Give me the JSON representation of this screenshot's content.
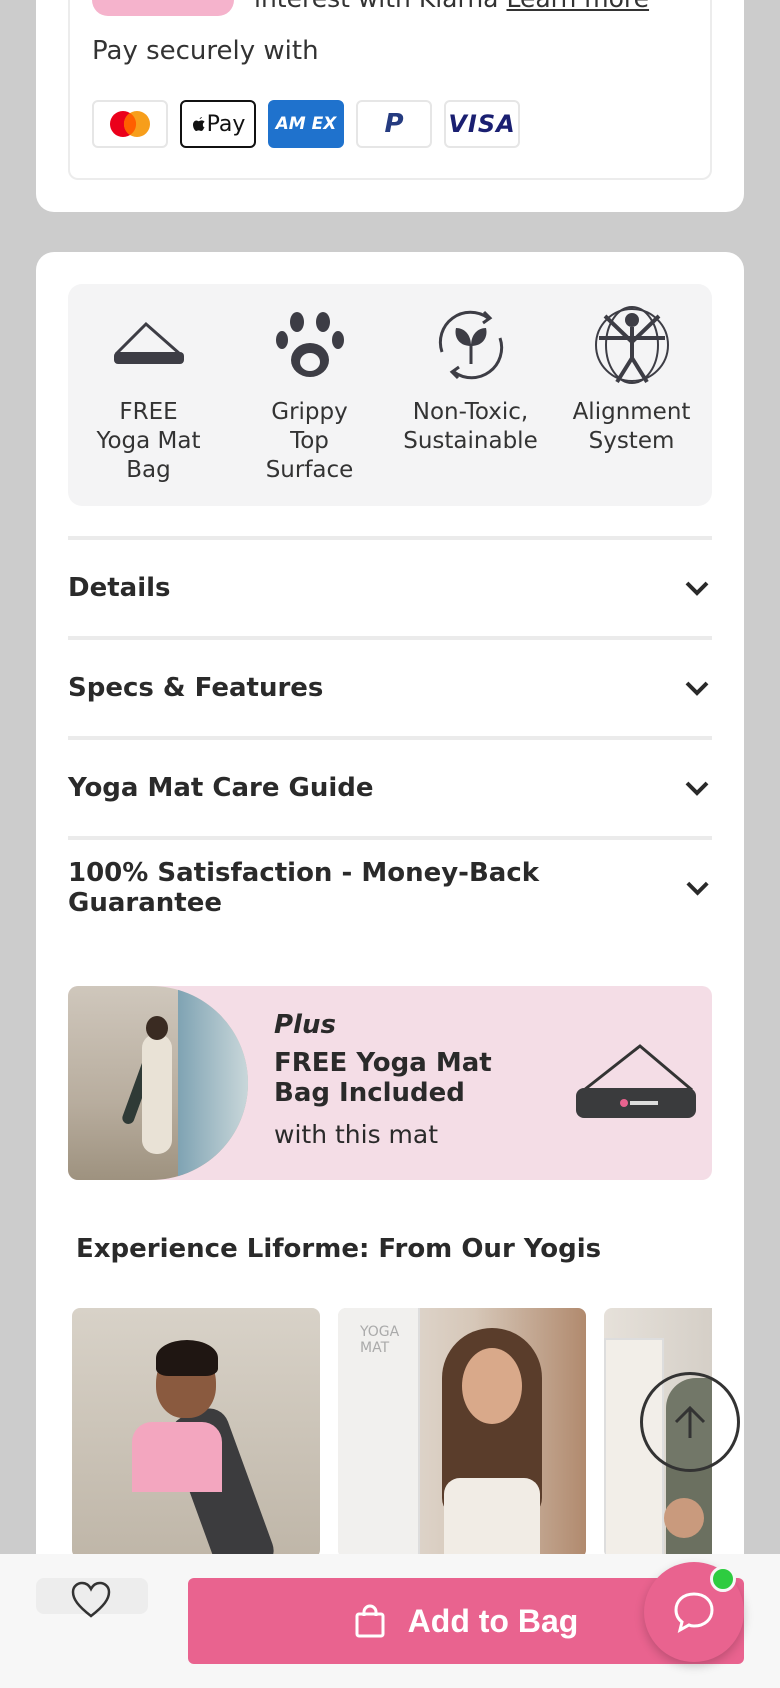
{
  "payment": {
    "klarna_text": "interest with Klarna",
    "klarna_link": "Learn more",
    "label": "Pay securely with",
    "methods": [
      "mastercard-icon",
      "apple-pay-icon",
      "amex-icon",
      "paypal-icon",
      "visa-icon"
    ],
    "apple_pay": "Pay",
    "amex": "AM EX",
    "paypal": "P",
    "visa": "VISA"
  },
  "features": [
    {
      "icon": "yoga-mat-bag-icon",
      "label": "FREE\nYoga Mat\nBag"
    },
    {
      "icon": "paw-icon",
      "label": "Grippy\nTop\nSurface"
    },
    {
      "icon": "eco-cycle-icon",
      "label": "Non-Toxic,\nSustainable"
    },
    {
      "icon": "vitruvian-man-icon",
      "label": "Alignment\nSystem"
    }
  ],
  "accordion": [
    {
      "title": "Details"
    },
    {
      "title": "Specs & Features"
    },
    {
      "title": "Yoga Mat Care Guide"
    },
    {
      "title": "100% Satisfaction - Money-Back Guarantee"
    }
  ],
  "promo": {
    "plus": "Plus",
    "title": "FREE Yoga Mat Bag Included",
    "subtitle": "with this mat"
  },
  "ugc": {
    "title": "Experience Liforme: From Our Yogis",
    "box_text": "YOGA MAT"
  },
  "bottom_bar": {
    "add_to_bag": "Add to Bag"
  },
  "colors": {
    "accent": "#e9638f",
    "promo_bg": "#f4dde6",
    "online_dot": "#2ecc40"
  }
}
